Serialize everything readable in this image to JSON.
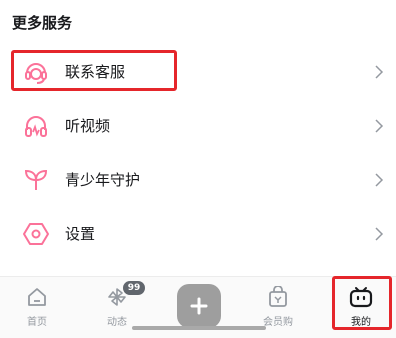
{
  "section": {
    "title": "更多服务"
  },
  "menu": [
    {
      "id": "customer-service",
      "label": "联系客服",
      "icon": "headset-icon"
    },
    {
      "id": "listen-video",
      "label": "听视频",
      "icon": "headphones-icon"
    },
    {
      "id": "teen-mode",
      "label": "青少年守护",
      "icon": "sprout-icon"
    },
    {
      "id": "settings",
      "label": "设置",
      "icon": "hexagon-settings-icon"
    }
  ],
  "tabs": [
    {
      "id": "home",
      "label": "首页",
      "icon": "home-icon"
    },
    {
      "id": "dynamic",
      "label": "动态",
      "icon": "pinwheel-icon",
      "badge": "99"
    },
    {
      "id": "publish",
      "label": "",
      "icon": "plus-icon"
    },
    {
      "id": "vip-shop",
      "label": "会员购",
      "icon": "shopping-bag-icon"
    },
    {
      "id": "mine",
      "label": "我的",
      "icon": "tv-icon",
      "active": true
    }
  ],
  "colors": {
    "accent_pink": "#fb7299",
    "highlight_red": "#e5262b",
    "text": "#18191c",
    "muted": "#9499a0"
  }
}
